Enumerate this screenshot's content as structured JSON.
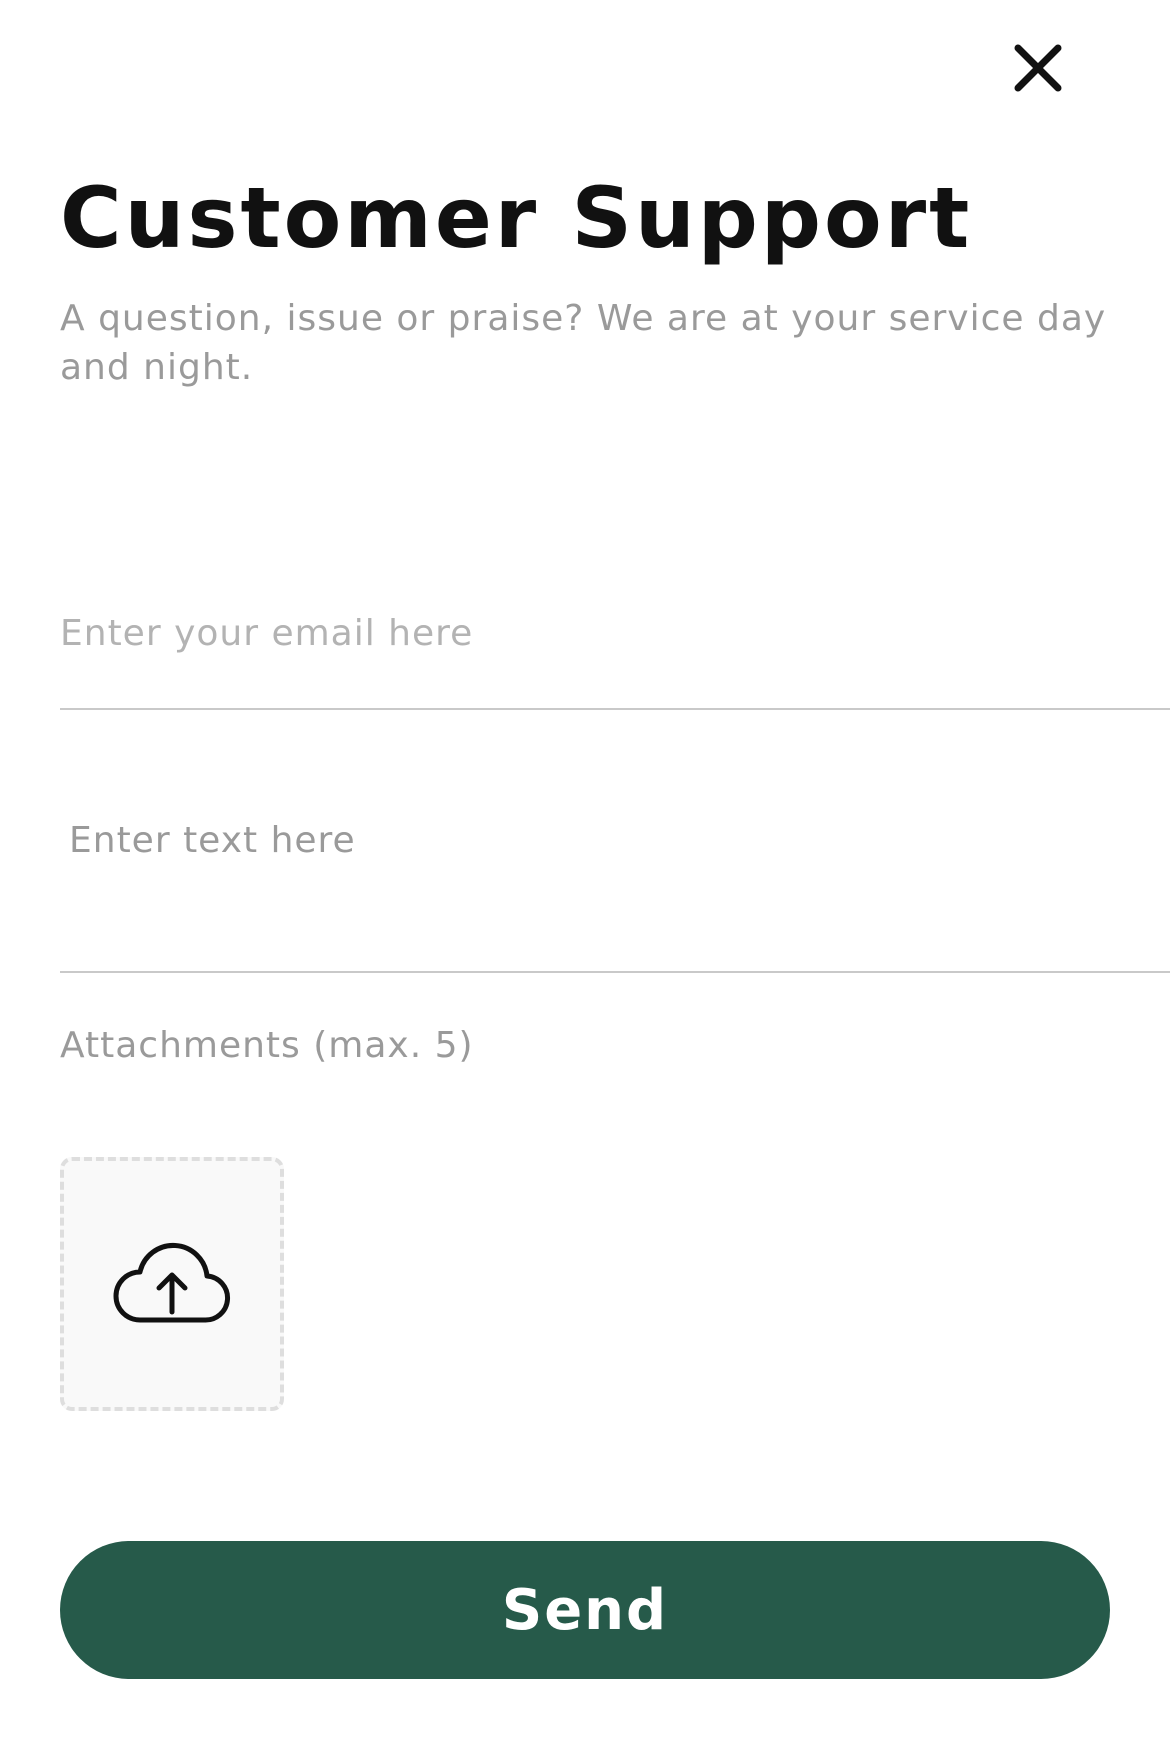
{
  "header": {
    "close_icon": "close-icon"
  },
  "title": "Customer Support",
  "subtitle": "A question, issue or praise? We are at your service day and night.",
  "form": {
    "email": {
      "value": "",
      "placeholder": "Enter your email here"
    },
    "message": {
      "value": "",
      "placeholder": "Enter text here"
    },
    "attachments_label": "Attachments (max. 5)",
    "upload_icon": "cloud-upload-icon",
    "send_label": "Send"
  },
  "colors": {
    "primary": "#265a4a",
    "title": "#111111",
    "muted_text": "#9a9a9a",
    "divider": "#c9c9c9"
  }
}
